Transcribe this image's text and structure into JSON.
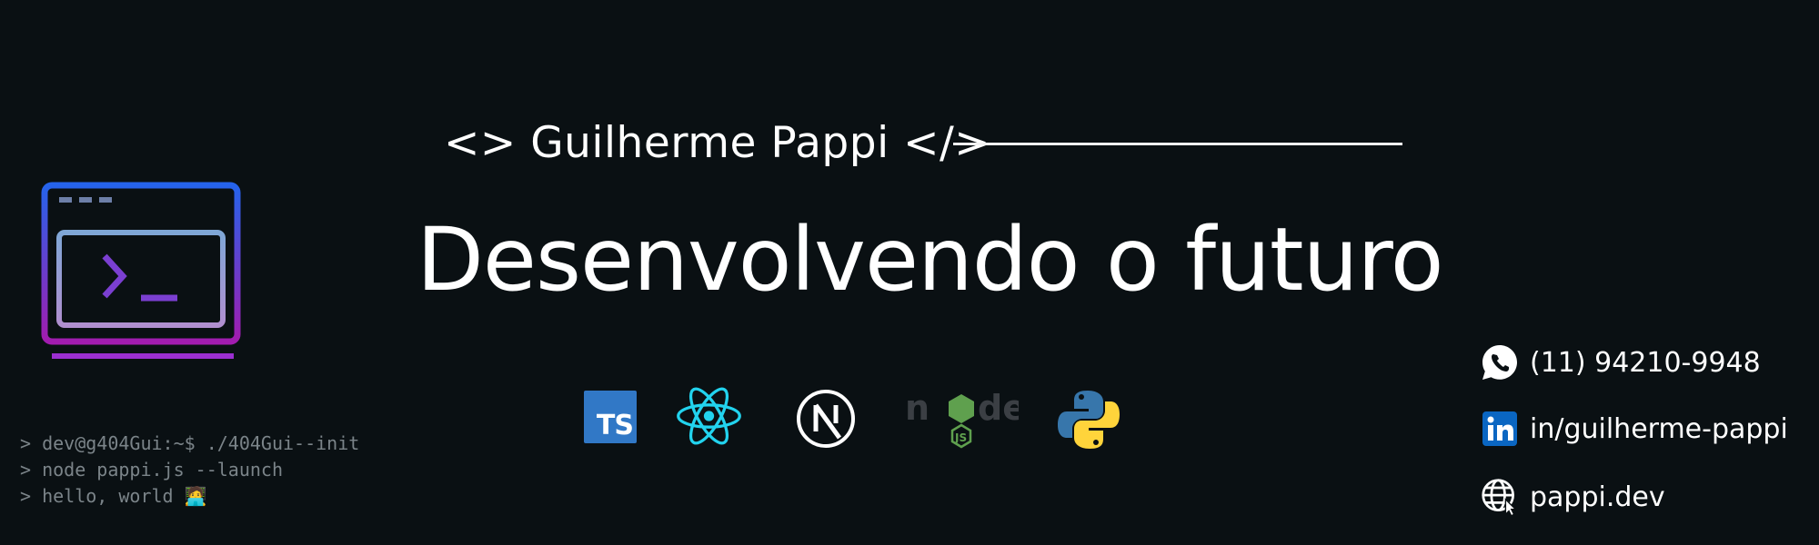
{
  "header": {
    "name_tag": "<> Guilherme Pappi </>",
    "headline": "Desenvolvendo o futuro"
  },
  "tech_stack": [
    {
      "name": "typescript-icon",
      "label": "TS",
      "color": "#3178c6"
    },
    {
      "name": "react-icon",
      "color": "#22d3ee"
    },
    {
      "name": "nextjs-icon",
      "color": "#ffffff"
    },
    {
      "name": "nodejs-icon",
      "label": "node",
      "sub_label": "JS",
      "color": "#5fa04e"
    },
    {
      "name": "python-icon",
      "colors": [
        "#3776ab",
        "#ffd43b"
      ]
    }
  ],
  "terminal": {
    "lines": [
      "> dev@g404Gui:~$ ./404Gui--init",
      "> node pappi.js --launch",
      "> hello, world 🧑‍💻"
    ]
  },
  "contacts": {
    "phone": "(11) 94210-9948",
    "linkedin": "in/guilherme-pappi",
    "website": "pappi.dev"
  },
  "colors": {
    "background": "#0a1013",
    "text": "#ffffff",
    "terminal_text": "#7b8489",
    "icon_gradient_top": "#2b6bea",
    "icon_gradient_bottom": "#a02ed6"
  }
}
